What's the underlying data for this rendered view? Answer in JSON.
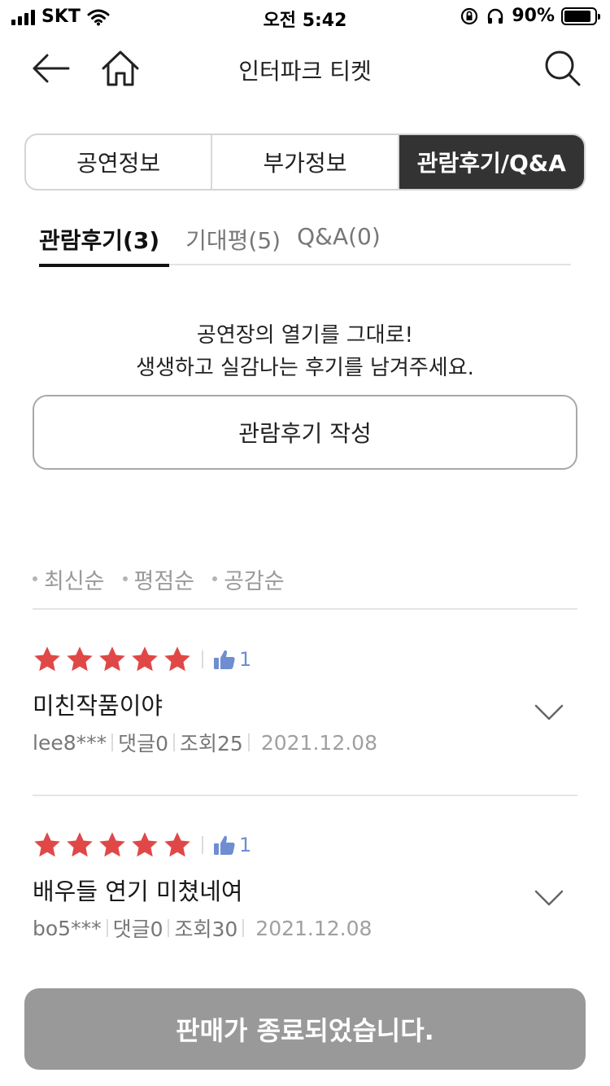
{
  "status_bar": {
    "carrier": "SKT",
    "time": "오전 5:42",
    "battery_text": "90%",
    "battery_level": 0.9
  },
  "header": {
    "title": "인터파크 티켓"
  },
  "main_tabs": [
    {
      "label": "공연정보",
      "active": false
    },
    {
      "label": "부가정보",
      "active": false
    },
    {
      "label": "관람후기/Q&A",
      "active": true
    }
  ],
  "sub_tabs": [
    {
      "label": "관람후기(3)",
      "active": true
    },
    {
      "label": "기대평(5)",
      "active": false
    },
    {
      "label": "Q&A(0)",
      "active": false
    }
  ],
  "prompt": {
    "line1": "공연장의 열기를 그대로!",
    "line2": "생생하고 실감나는 후기를 남겨주세요."
  },
  "write_button": "관람후기 작성",
  "sort_options": [
    "최신순",
    "평점순",
    "공감순"
  ],
  "reviews": [
    {
      "rating": 5,
      "likes": "1",
      "title": "미친작품이야",
      "user": "lee8***",
      "comments": "댓글0",
      "views": "조회25",
      "date": "2021.12.08"
    },
    {
      "rating": 5,
      "likes": "1",
      "title": "배우들 연기 미쳤네여",
      "user": "bo5***",
      "comments": "댓글0",
      "views": "조회30",
      "date": "2021.12.08"
    }
  ],
  "bottom_bar": {
    "label": "판매가 종료되었습니다."
  },
  "colors": {
    "star": "#e04848",
    "like": "#6f8ed1",
    "active_tab": "#333333",
    "disabled_button": "#999999"
  }
}
